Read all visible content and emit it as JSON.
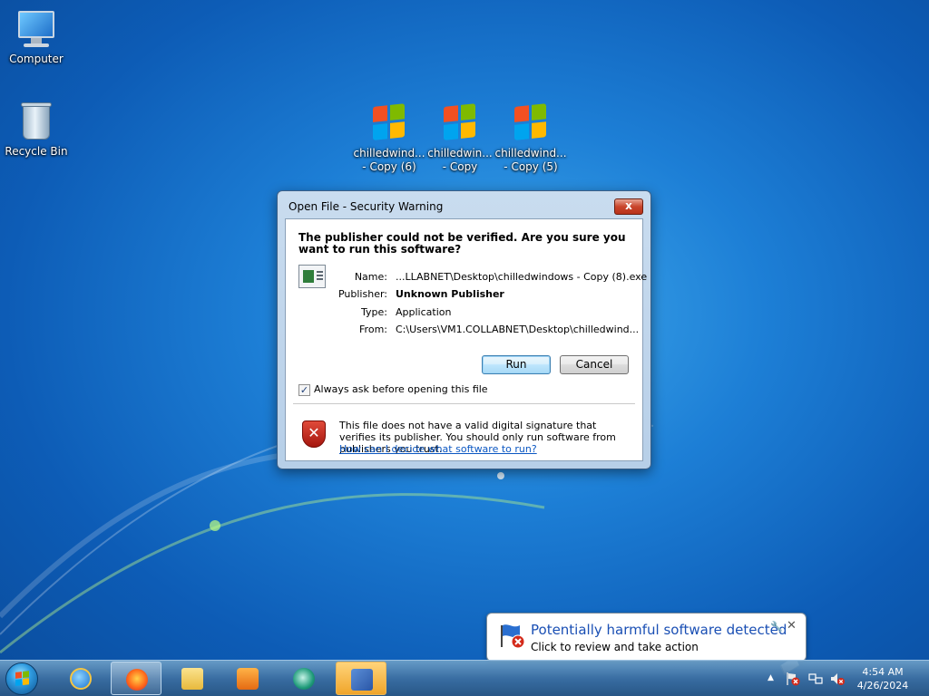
{
  "desktop": {
    "icons": [
      {
        "label": "Computer"
      },
      {
        "label": "Recycle Bin"
      },
      {
        "label_line1": "chilledwind...",
        "label_line2": "- Copy (6)"
      },
      {
        "label_line1": "chilledwin...",
        "label_line2": "- Copy"
      },
      {
        "label_line1": "chilledwind...",
        "label_line2": "- Copy (5)"
      }
    ]
  },
  "dialog": {
    "title": "Open File - Security Warning",
    "close_label": "x",
    "question": "The publisher could not be verified.  Are you sure you want to run this software?",
    "fields": {
      "name_key": "Name:",
      "name_value": "...LLABNET\\Desktop\\chilledwindows - Copy (8).exe",
      "publisher_key": "Publisher:",
      "publisher_value": "Unknown Publisher",
      "type_key": "Type:",
      "type_value": "Application",
      "from_key": "From:",
      "from_value": "C:\\Users\\VM1.COLLABNET\\Desktop\\chilledwind..."
    },
    "run_label": "Run",
    "cancel_label": "Cancel",
    "checkbox_checked": true,
    "checkbox_mark": "✓",
    "checkbox_label": "Always ask before opening this file",
    "warning_text": "This file does not have a valid digital signature that verifies its publisher.  You should only run software from publishers you trust.",
    "warning_link": "How can I decide what software to run?"
  },
  "balloon": {
    "title": "Potentially harmful software detected",
    "subtitle": "Click to review and take action",
    "close_label": "✕"
  },
  "taskbar": {
    "apps": [
      "start-orb",
      "internet-explorer-icon",
      "firefox-icon",
      "explorer-icon",
      "media-player-icon",
      "network-icon",
      "chilledwindows-icon"
    ],
    "tray_expand": "▲",
    "time": "4:54 AM",
    "date": "4/26/2024"
  },
  "colors": {
    "accent_link": "#0b57c2",
    "balloon_title": "#1a4fb4",
    "close_red": "#c9452c"
  }
}
